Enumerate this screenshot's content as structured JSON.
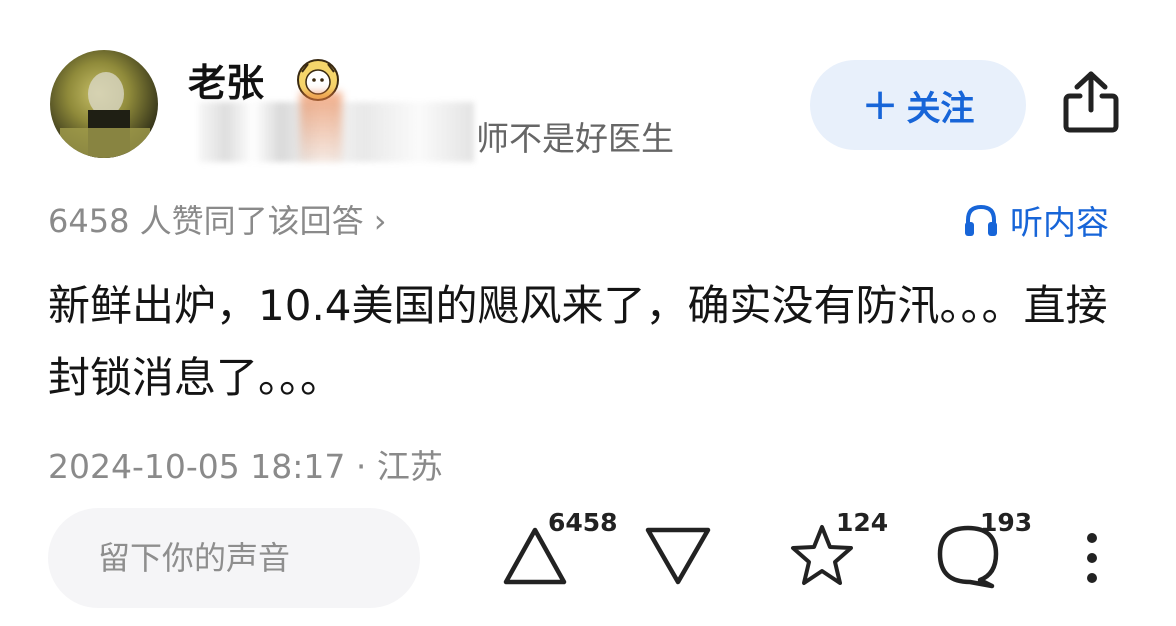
{
  "author": {
    "name": "老张",
    "bio_visible": "师不是好医生"
  },
  "follow": {
    "plus": "+",
    "label": "关注"
  },
  "vote_summary": "6458 人赞同了该回答 ›",
  "listen": {
    "label": "听内容"
  },
  "content": "新鲜出炉，10.4美国的飓风来了，确实没有防汛。。。直接封锁消息了。。。",
  "meta": "2024-10-05 18:17 · 江苏",
  "comment": {
    "placeholder": "留下你的声音"
  },
  "actions": {
    "upvote_count": "6458",
    "favorite_count": "124",
    "comment_count": "193"
  },
  "colors": {
    "accent": "#1765d8",
    "follow_bg": "#e8f0fb",
    "muted": "#8a8a8a"
  },
  "icons": [
    "share-icon",
    "headphones-icon",
    "upvote-icon",
    "downvote-icon",
    "star-icon",
    "comment-icon",
    "more-icon",
    "badge-icon"
  ]
}
